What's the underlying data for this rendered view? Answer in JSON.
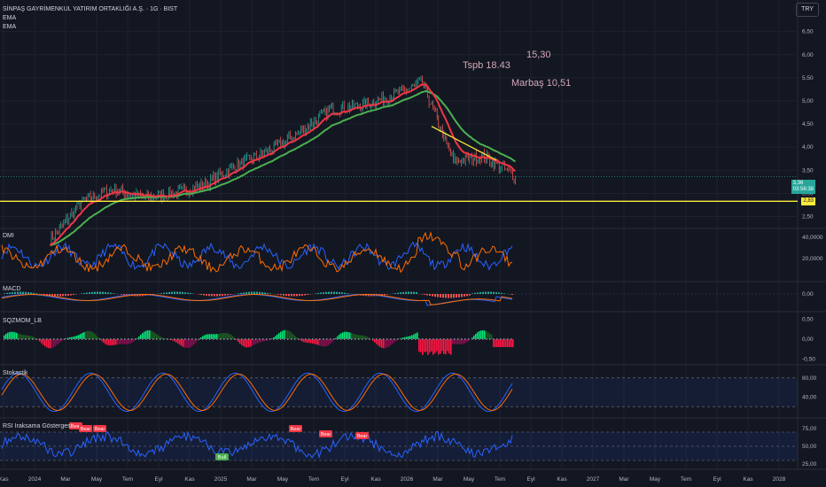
{
  "header": {
    "title": "SİNPAŞ GAYRİMENKUL YATIRIM ORTAKLIĞI A.Ş. · 1G · BIST",
    "indicator1": "EMA",
    "indicator2": "EMA",
    "currency": "TRY"
  },
  "annotations": {
    "tspb": "Tspb 18.43",
    "value1530": "15,30",
    "marbas": "Marbaş 10,51"
  },
  "price_tags": {
    "current_price": "3,36",
    "countdown": "03:56:38",
    "support_level": "2,83"
  },
  "panes": {
    "dmi": "DMI",
    "macd": "MACD",
    "sqzmom": "SQZMOM_LB",
    "stoch": "Stokastik",
    "rsi": "RSI Iraksama Göstergesi"
  },
  "rsi_labels": [
    "Bear",
    "Bear",
    "Bear",
    "Bull",
    "Bear",
    "Bear",
    "Bear"
  ],
  "x_axis_labels": [
    "Kas",
    "2024",
    "Mar",
    "May",
    "Tem",
    "Eyl",
    "Kas",
    "2025",
    "Mar",
    "May",
    "Tem",
    "Eyl",
    "Kas",
    "2026",
    "Mar",
    "May",
    "Tem",
    "Eyl",
    "Kas",
    "2027",
    "Mar",
    "May",
    "Tem",
    "Eyl",
    "Kas",
    "2028"
  ],
  "colors": {
    "background": "#131722",
    "grid": "#1e222d",
    "price": "#26a69a",
    "ema_fast": "#f23645",
    "ema_slow": "#4caf50",
    "support": "#ffeb3b",
    "dmi_plus": "#2962ff",
    "dmi_minus": "#ff6d00",
    "bull": "#00e676",
    "bear": "#ff1744"
  },
  "chart_data": [
    {
      "type": "line",
      "title": "SİNPAŞ GAYRİMENKUL YATIRIM ORTAKLIĞI A.Ş. · 1G · BIST",
      "xlabel": "",
      "ylabel": "",
      "x": [
        "2024-02",
        "2024-04",
        "2024-06",
        "2024-08",
        "2024-10",
        "2024-12",
        "2025-02",
        "2025-04",
        "2025-06",
        "2025-08",
        "2025-10",
        "2025-12",
        "2026-02",
        "2026-04",
        "2026-06",
        "2026-08"
      ],
      "series": [
        {
          "name": "",
          "values": [
            2.0,
            2.8,
            3.1,
            2.9,
            3.0,
            3.2,
            3.6,
            3.9,
            4.3,
            4.8,
            4.9,
            5.1,
            5.4,
            3.7,
            3.8,
            3.36
          ]
        }
      ],
      "ylim": [
        2.3,
        6.8
      ],
      "yticks": [
        "6,50",
        "6,00",
        "5,50",
        "5,00",
        "4,50",
        "4,00",
        "3,50",
        "3,00",
        "2,50"
      ],
      "support_value": 2.83
    },
    {
      "type": "line",
      "title": "DMI",
      "yticks": [
        "40,0000",
        "20,0000"
      ],
      "ylim": [
        0,
        45000
      ]
    },
    {
      "type": "line",
      "title": "MACD",
      "yticks": [
        "0,00"
      ]
    },
    {
      "type": "bar",
      "title": "SQZMOM_LB",
      "yticks": [
        "0,50",
        "0,00",
        "-0,50"
      ],
      "ylim": [
        -0.6,
        0.6
      ]
    },
    {
      "type": "line",
      "title": "Stokastik",
      "yticks": [
        "80,00",
        "40,00"
      ],
      "ylim": [
        0,
        100
      ]
    },
    {
      "type": "line",
      "title": "RSI Iraksama Göstergesi",
      "yticks": [
        "75,00",
        "50,00",
        "25,00"
      ],
      "ylim": [
        20,
        85
      ]
    }
  ]
}
